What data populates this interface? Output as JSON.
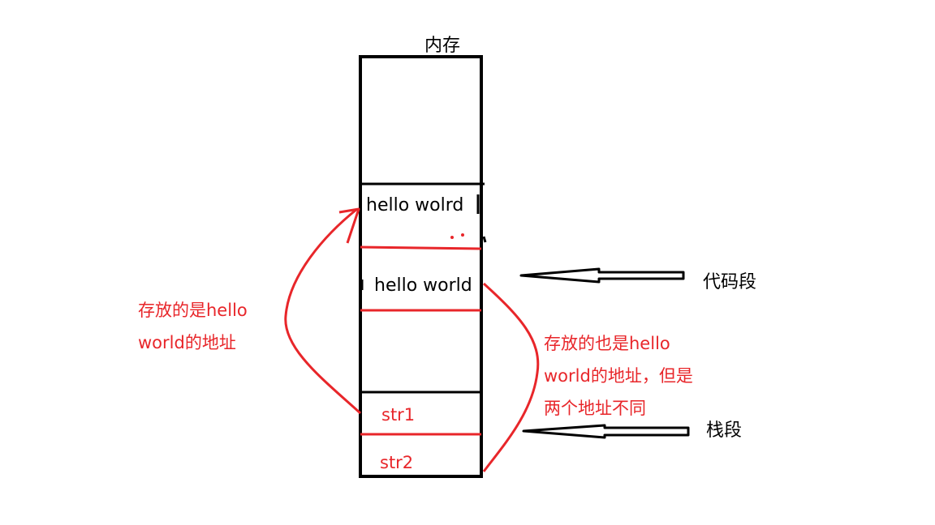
{
  "memory": {
    "title": "内存",
    "cell_text_1": "hello wolrd",
    "cell_text_2": "hello world",
    "var1": "str1",
    "var2": "str2"
  },
  "segments": {
    "code_segment": "代码段",
    "stack_segment": "栈段"
  },
  "annotations": {
    "left_line1": "存放的是hello",
    "left_line2": "world的地址",
    "right_line1": "存放的也是hello",
    "right_line2": "world的地址，但是",
    "right_line3": "两个地址不同"
  },
  "colors": {
    "outline": "#000000",
    "annotation": "#e8262a"
  }
}
